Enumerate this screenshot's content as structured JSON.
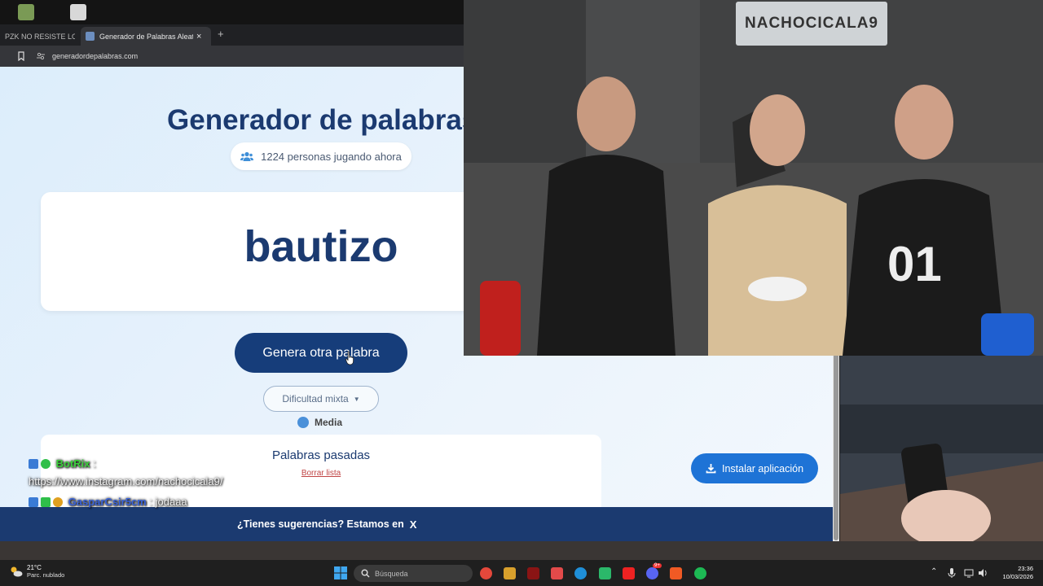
{
  "browser": {
    "tabs": [
      {
        "label": "PZK NO RESISTE LOS CH"
      },
      {
        "label": "Generador de Palabras Aleatorias"
      }
    ],
    "new_tab_symbol": "+",
    "close_symbol": "×",
    "url": "generadordepalabras.com"
  },
  "page": {
    "title": "Generador de palabras",
    "players_online": "1224 personas jugando ahora",
    "current_word": "bautizo",
    "difficulty_label": "Media",
    "generate_button": "Genera otra palabra",
    "difficulty_select": "Dificultad mixta",
    "past_words_title": "Palabras pasadas",
    "clear_list_link": "Borrar lista",
    "install_button": "Instalar aplicación",
    "footer_text": "¿Tienes sugerencias? Estamos en",
    "footer_social": "X"
  },
  "chat": [
    {
      "user": "BotRix",
      "sep": ":",
      "message": ""
    },
    {
      "user": "",
      "sep": "",
      "message": "https://www.instagram.com/nachocicala9/"
    },
    {
      "user": "GasparCsir5cm",
      "sep": ":",
      "message": "jodaaa"
    }
  ],
  "stream": {
    "sign_text": "NACHOCICALA9"
  },
  "taskbar": {
    "temperature": "21°C",
    "weather": "Parc. nublado",
    "search_placeholder": "Búsqueda",
    "time": "23:36",
    "date": "10/03/2026",
    "discord_badge": "9+"
  },
  "colors": {
    "brand_navy": "#1b3a70",
    "button_navy": "#163d7a",
    "install_blue": "#1e73d6",
    "username_green": "#3ccf3c",
    "username_blue": "#3a63d8"
  }
}
